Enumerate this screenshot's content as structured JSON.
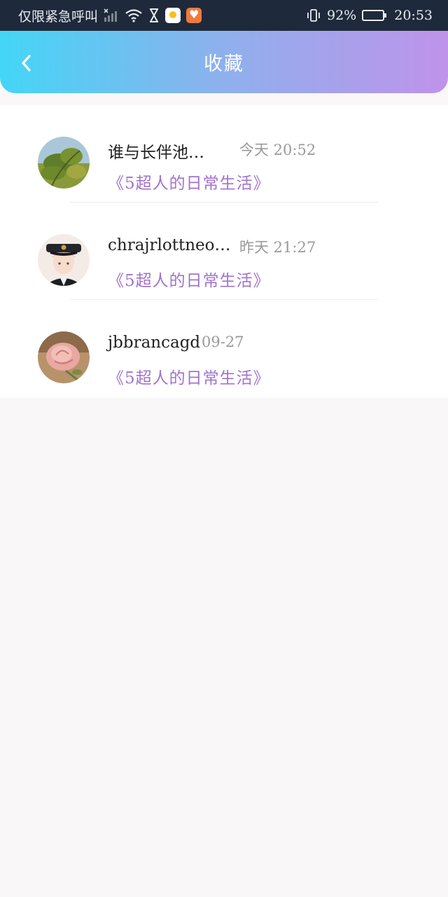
{
  "status_bar": {
    "carrier": "仅限紧急呼叫",
    "battery": "92%",
    "time": "20:53"
  },
  "header": {
    "title": "收藏"
  },
  "favorites": [
    {
      "name": "谁与长伴池…",
      "time": "今天  20:52",
      "title": "《5超人的日常生活》"
    },
    {
      "name": "chrajrlottneo…",
      "time": "昨天  21:27",
      "title": "《5超人的日常生活》"
    },
    {
      "name": "jbbrancagd",
      "time": "09-27",
      "title": "《5超人的日常生活》"
    }
  ],
  "colors": {
    "header_gradient_start": "#43d6f6",
    "header_gradient_end": "#bf93e9",
    "title_purple": "#a173cc"
  },
  "battery_level": 0.92
}
